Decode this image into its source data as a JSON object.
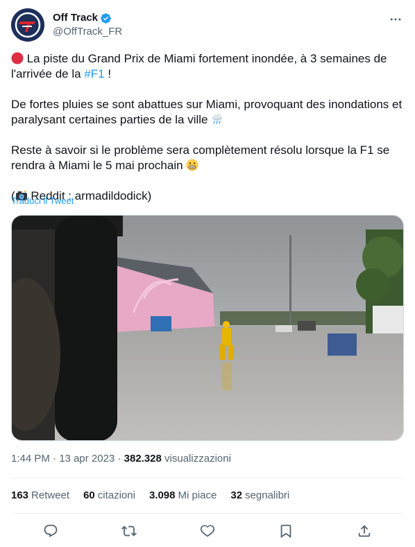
{
  "author": {
    "display_name": "Off Track",
    "handle": "@OffTrack_FR",
    "avatar_icon": "off-track-logo",
    "verified_icon": "verified-badge-icon"
  },
  "more_icon": "more-dots-icon",
  "tweet": {
    "line1_pre": " La piste du Grand Prix de Miami fortement inondée, à 3 semaines de l'arrivée de la ",
    "hashtag": "#F1",
    "line1_post": " !",
    "para2": "De fortes pluies se sont abattues sur Miami, provoquant des inondations et paralysant certaines parties de la ville ",
    "para3": "Reste à savoir si le problème sera complètement résolu lorsque la F1 se rendra à Miami le 5 mai prochain ",
    "credit_open": "(",
    "credit_text": " Reddit : armadildodick)"
  },
  "translate_label": "Traduci il Tweet",
  "meta": {
    "time": "1:44 PM",
    "separator": " · ",
    "date": "13 apr 2023",
    "views_count": "382.328",
    "views_label": " visualizzazioni"
  },
  "stats": [
    {
      "count": "163",
      "label": "Retweet"
    },
    {
      "count": "60",
      "label": "citazioni"
    },
    {
      "count": "3.098",
      "label": "Mi piace"
    },
    {
      "count": "32",
      "label": "segnalibri"
    }
  ],
  "actions": [
    {
      "icon": "reply-icon"
    },
    {
      "icon": "retweet-icon"
    },
    {
      "icon": "like-icon"
    },
    {
      "icon": "bookmark-icon"
    },
    {
      "icon": "share-icon"
    }
  ],
  "colors": {
    "accent": "#1d9bf0",
    "text_primary": "#0f1419",
    "text_secondary": "#536471",
    "divider": "#eff3f4"
  }
}
